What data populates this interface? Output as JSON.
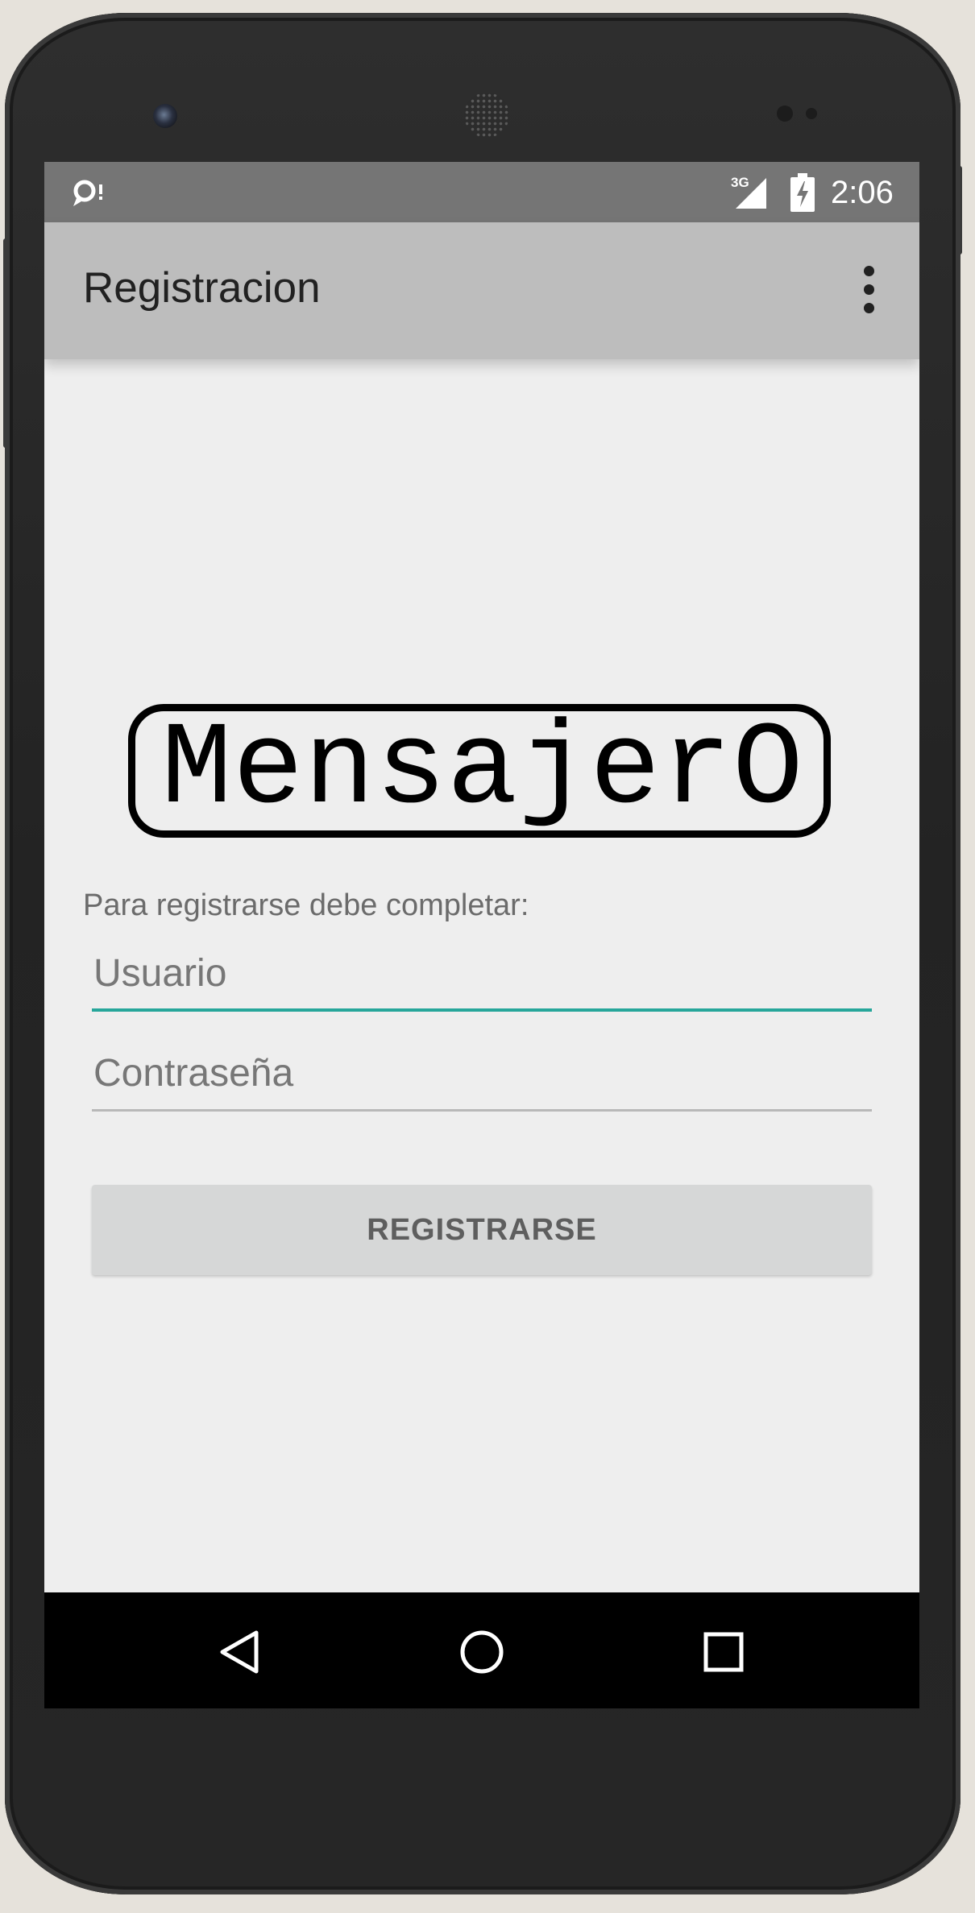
{
  "status_bar": {
    "time": "2:06",
    "network_label": "3G",
    "left_icon": "notification-icon",
    "signal_icon": "signal-icon",
    "battery_icon": "battery-icon"
  },
  "app_bar": {
    "title": "Registracion",
    "menu_icon": "overflow-menu-icon"
  },
  "logo": {
    "text": "MensajerO"
  },
  "form": {
    "instructions": "Para registrarse debe completar:",
    "username_placeholder": "Usuario",
    "password_placeholder": "Contraseña",
    "submit_label": "REGISTRARSE"
  },
  "nav_bar": {
    "back_icon": "back-triangle-icon",
    "home_icon": "home-circle-icon",
    "recents_icon": "recents-square-icon"
  },
  "colors": {
    "status_bar": "#757575",
    "app_bar": "#bdbdbd",
    "background": "#eeeeee",
    "accent_underline": "#26a69a",
    "button": "#d6d7d7"
  }
}
